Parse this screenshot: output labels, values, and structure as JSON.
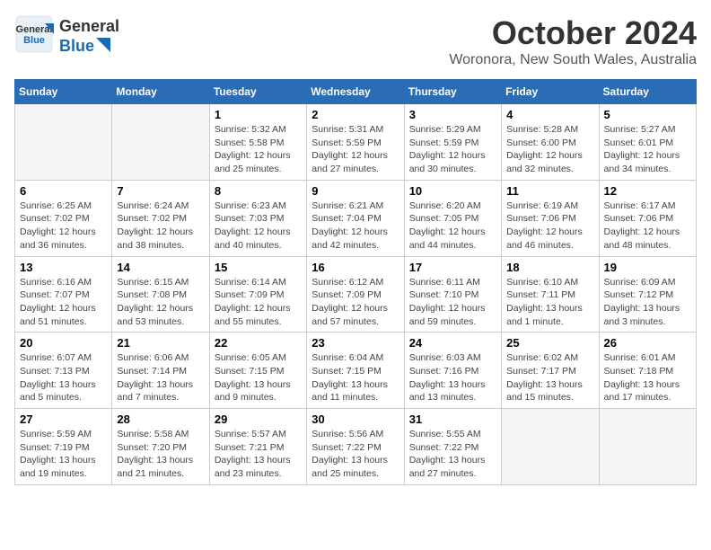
{
  "header": {
    "logo_line1": "General",
    "logo_line2": "Blue",
    "title": "October 2024",
    "subtitle": "Woronora, New South Wales, Australia"
  },
  "days_of_week": [
    "Sunday",
    "Monday",
    "Tuesday",
    "Wednesday",
    "Thursday",
    "Friday",
    "Saturday"
  ],
  "weeks": [
    [
      {
        "day": "",
        "empty": true
      },
      {
        "day": "",
        "empty": true
      },
      {
        "day": "1",
        "sunrise": "5:32 AM",
        "sunset": "5:58 PM",
        "daylight": "12 hours and 25 minutes."
      },
      {
        "day": "2",
        "sunrise": "5:31 AM",
        "sunset": "5:59 PM",
        "daylight": "12 hours and 27 minutes."
      },
      {
        "day": "3",
        "sunrise": "5:29 AM",
        "sunset": "5:59 PM",
        "daylight": "12 hours and 30 minutes."
      },
      {
        "day": "4",
        "sunrise": "5:28 AM",
        "sunset": "6:00 PM",
        "daylight": "12 hours and 32 minutes."
      },
      {
        "day": "5",
        "sunrise": "5:27 AM",
        "sunset": "6:01 PM",
        "daylight": "12 hours and 34 minutes."
      }
    ],
    [
      {
        "day": "6",
        "sunrise": "6:25 AM",
        "sunset": "7:02 PM",
        "daylight": "12 hours and 36 minutes."
      },
      {
        "day": "7",
        "sunrise": "6:24 AM",
        "sunset": "7:02 PM",
        "daylight": "12 hours and 38 minutes."
      },
      {
        "day": "8",
        "sunrise": "6:23 AM",
        "sunset": "7:03 PM",
        "daylight": "12 hours and 40 minutes."
      },
      {
        "day": "9",
        "sunrise": "6:21 AM",
        "sunset": "7:04 PM",
        "daylight": "12 hours and 42 minutes."
      },
      {
        "day": "10",
        "sunrise": "6:20 AM",
        "sunset": "7:05 PM",
        "daylight": "12 hours and 44 minutes."
      },
      {
        "day": "11",
        "sunrise": "6:19 AM",
        "sunset": "7:06 PM",
        "daylight": "12 hours and 46 minutes."
      },
      {
        "day": "12",
        "sunrise": "6:17 AM",
        "sunset": "7:06 PM",
        "daylight": "12 hours and 48 minutes."
      }
    ],
    [
      {
        "day": "13",
        "sunrise": "6:16 AM",
        "sunset": "7:07 PM",
        "daylight": "12 hours and 51 minutes."
      },
      {
        "day": "14",
        "sunrise": "6:15 AM",
        "sunset": "7:08 PM",
        "daylight": "12 hours and 53 minutes."
      },
      {
        "day": "15",
        "sunrise": "6:14 AM",
        "sunset": "7:09 PM",
        "daylight": "12 hours and 55 minutes."
      },
      {
        "day": "16",
        "sunrise": "6:12 AM",
        "sunset": "7:09 PM",
        "daylight": "12 hours and 57 minutes."
      },
      {
        "day": "17",
        "sunrise": "6:11 AM",
        "sunset": "7:10 PM",
        "daylight": "12 hours and 59 minutes."
      },
      {
        "day": "18",
        "sunrise": "6:10 AM",
        "sunset": "7:11 PM",
        "daylight": "13 hours and 1 minute."
      },
      {
        "day": "19",
        "sunrise": "6:09 AM",
        "sunset": "7:12 PM",
        "daylight": "13 hours and 3 minutes."
      }
    ],
    [
      {
        "day": "20",
        "sunrise": "6:07 AM",
        "sunset": "7:13 PM",
        "daylight": "13 hours and 5 minutes."
      },
      {
        "day": "21",
        "sunrise": "6:06 AM",
        "sunset": "7:14 PM",
        "daylight": "13 hours and 7 minutes."
      },
      {
        "day": "22",
        "sunrise": "6:05 AM",
        "sunset": "7:15 PM",
        "daylight": "13 hours and 9 minutes."
      },
      {
        "day": "23",
        "sunrise": "6:04 AM",
        "sunset": "7:15 PM",
        "daylight": "13 hours and 11 minutes."
      },
      {
        "day": "24",
        "sunrise": "6:03 AM",
        "sunset": "7:16 PM",
        "daylight": "13 hours and 13 minutes."
      },
      {
        "day": "25",
        "sunrise": "6:02 AM",
        "sunset": "7:17 PM",
        "daylight": "13 hours and 15 minutes."
      },
      {
        "day": "26",
        "sunrise": "6:01 AM",
        "sunset": "7:18 PM",
        "daylight": "13 hours and 17 minutes."
      }
    ],
    [
      {
        "day": "27",
        "sunrise": "5:59 AM",
        "sunset": "7:19 PM",
        "daylight": "13 hours and 19 minutes."
      },
      {
        "day": "28",
        "sunrise": "5:58 AM",
        "sunset": "7:20 PM",
        "daylight": "13 hours and 21 minutes."
      },
      {
        "day": "29",
        "sunrise": "5:57 AM",
        "sunset": "7:21 PM",
        "daylight": "13 hours and 23 minutes."
      },
      {
        "day": "30",
        "sunrise": "5:56 AM",
        "sunset": "7:22 PM",
        "daylight": "13 hours and 25 minutes."
      },
      {
        "day": "31",
        "sunrise": "5:55 AM",
        "sunset": "7:22 PM",
        "daylight": "13 hours and 27 minutes."
      },
      {
        "day": "",
        "empty": true
      },
      {
        "day": "",
        "empty": true
      }
    ]
  ],
  "labels": {
    "sunrise": "Sunrise:",
    "sunset": "Sunset:",
    "daylight": "Daylight:"
  }
}
